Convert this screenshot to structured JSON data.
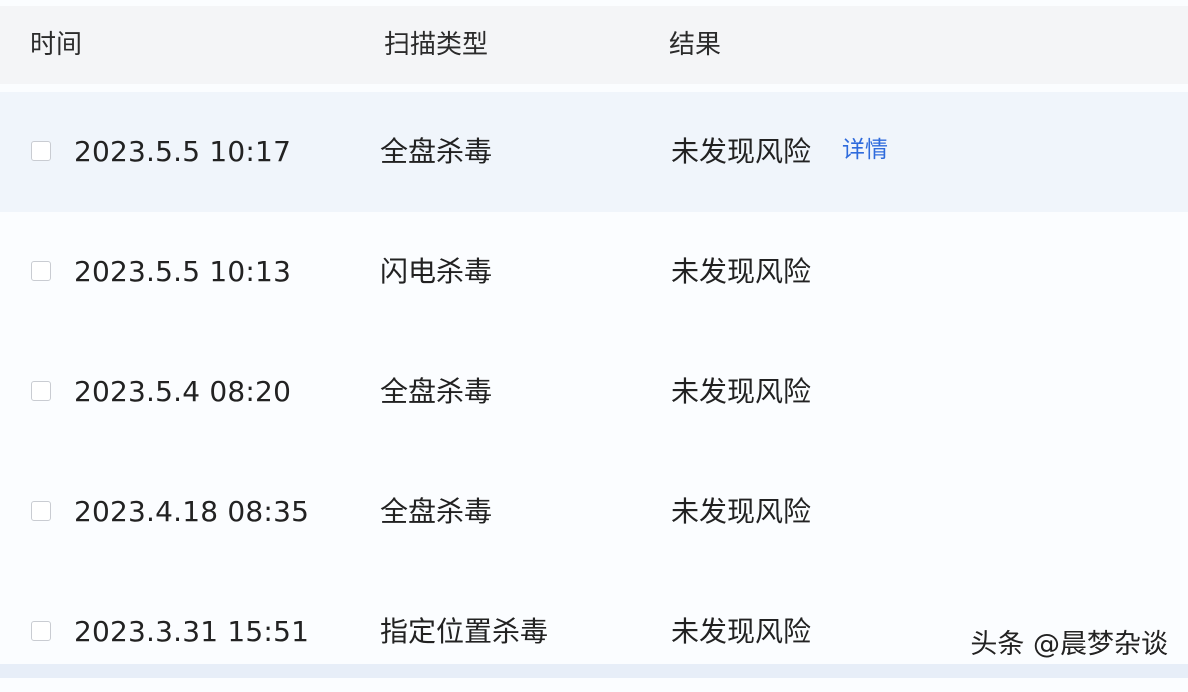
{
  "table": {
    "headers": {
      "time": "时间",
      "scan_type": "扫描类型",
      "result": "结果"
    },
    "rows": [
      {
        "time": "2023.5.5 10:17",
        "scan_type": "全盘杀毒",
        "result": "未发现风险",
        "detail": "详情",
        "highlighted": true
      },
      {
        "time": "2023.5.5 10:13",
        "scan_type": "闪电杀毒",
        "result": "未发现风险"
      },
      {
        "time": "2023.5.4 08:20",
        "scan_type": "全盘杀毒",
        "result": "未发现风险"
      },
      {
        "time": "2023.4.18 08:35",
        "scan_type": "全盘杀毒",
        "result": "未发现风险"
      },
      {
        "time": "2023.3.31 15:51",
        "scan_type": "指定位置杀毒",
        "result": "未发现风险"
      }
    ]
  },
  "watermark": "头条 @晨梦杂谈",
  "colors": {
    "header_bg": "#f4f5f7",
    "row_highlight_bg": "#f0f5fb",
    "link": "#2f6bdc"
  }
}
